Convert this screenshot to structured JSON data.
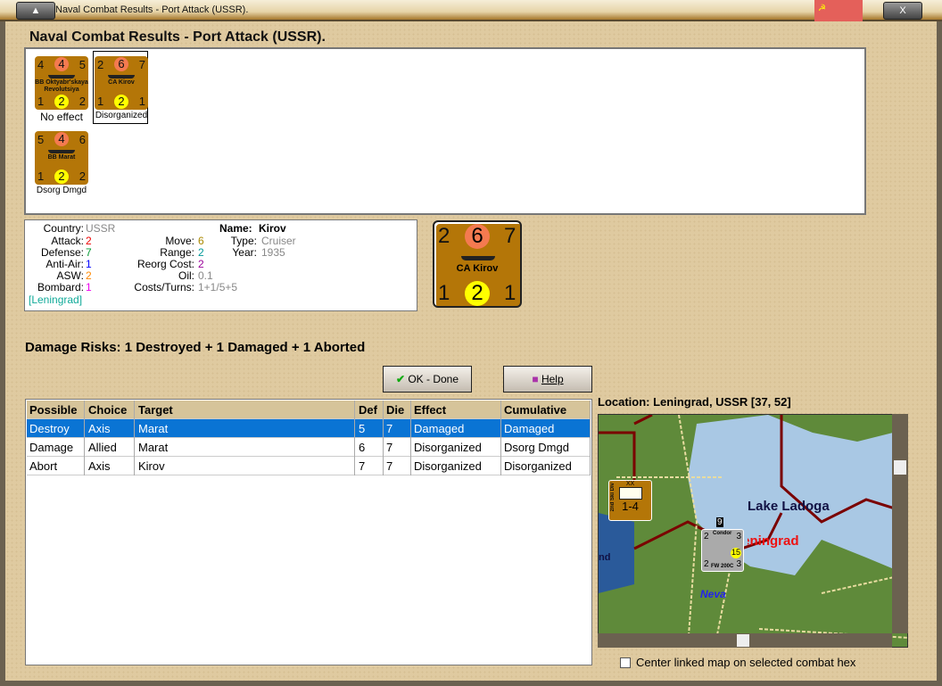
{
  "window": {
    "title": "Naval Combat Results - Port Attack (USSR).",
    "flag_icon": "hammer-sickle"
  },
  "heading": "Naval Combat Results - Port Attack (USSR).",
  "units": [
    {
      "tl": "4",
      "tc": "4",
      "tr": "5",
      "name": "BB Oktyabr'skaya Revolutsiya",
      "bl": "1",
      "bc": "2",
      "br": "2",
      "result": "No effect"
    },
    {
      "tl": "2",
      "tc": "6",
      "tr": "7",
      "name": "CA Kirov",
      "bl": "1",
      "bc": "2",
      "br": "1",
      "result": "Disorganized",
      "selected": true
    },
    {
      "tl": "5",
      "tc": "4",
      "tr": "6",
      "name": "BB Marat",
      "bl": "1",
      "bc": "2",
      "br": "2",
      "result": "Dsorg Dmgd"
    }
  ],
  "info": {
    "country_l": "Country:",
    "country": "USSR",
    "attack_l": "Attack:",
    "attack": "2",
    "defense_l": "Defense:",
    "defense": "7",
    "aa_l": "Anti-Air:",
    "aa": "1",
    "asw_l": "ASW:",
    "asw": "2",
    "bombard_l": "Bombard:",
    "bombard": "1",
    "location": "[Leningrad]",
    "move_l": "Move:",
    "move": "6",
    "range_l": "Range:",
    "range": "2",
    "reorg_l": "Reorg Cost:",
    "reorg": "2",
    "oil_l": "Oil:",
    "oil": "0.1",
    "costs_l": "Costs/Turns:",
    "costs": "1+1/5+5",
    "name_l": "Name:",
    "name": "Kirov",
    "type_l": "Type:",
    "type": "Cruiser",
    "year_l": "Year:",
    "year": "1935"
  },
  "big_counter": {
    "tl": "2",
    "tc": "6",
    "tr": "7",
    "name": "CA Kirov",
    "bl": "1",
    "bc": "2",
    "br": "1"
  },
  "damage_risks": "Damage Risks:  1 Destroyed + 1 Damaged + 1 Aborted",
  "buttons": {
    "ok": "OK - Done",
    "help": "Help"
  },
  "table": {
    "headers": [
      "Possible",
      "Choice",
      "Target",
      "Def",
      "Die",
      "Effect",
      "Cumulative"
    ],
    "rows": [
      [
        "Destroy",
        "Axis",
        "Marat",
        "5",
        "7",
        "Damaged",
        "Damaged"
      ],
      [
        "Damage",
        "Allied",
        "Marat",
        "6",
        "7",
        "Disorganized",
        "Dsorg Dmgd"
      ],
      [
        "Abort",
        "Axis",
        "Kirov",
        "7",
        "7",
        "Disorganized",
        "Disorganized"
      ]
    ],
    "selected_row": 0
  },
  "location": "Location:  Leningrad, USSR [37, 52]",
  "map": {
    "lake": "Lake Ladoga",
    "city": "Leningrad",
    "river": "Neva",
    "sea_fragment": "nd",
    "land_unit": {
      "type": "XX",
      "label": "2nd Ski Div",
      "value": "1-4"
    },
    "air_unit": {
      "name": "Condor",
      "model": "FW 200C",
      "tl": "2",
      "tr": "3",
      "bl": "2",
      "br": "3",
      "range": "15",
      "stack": "9"
    }
  },
  "center_checkbox": {
    "label": "Center linked map on selected combat hex",
    "checked": false
  }
}
